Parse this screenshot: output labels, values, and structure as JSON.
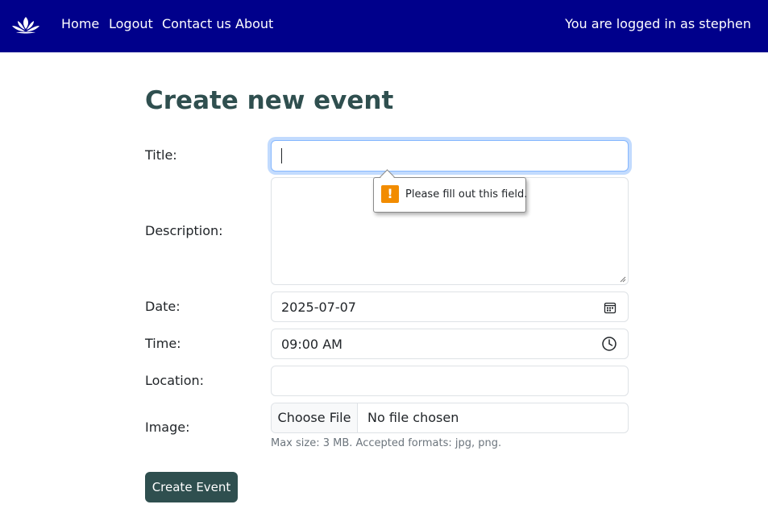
{
  "nav": {
    "logo": "lotus-logo-icon",
    "links": [
      "Home",
      "Logout",
      "Contact us",
      "About"
    ],
    "user_status": "You are logged in as stephen"
  },
  "form": {
    "heading": "Create new event",
    "labels": {
      "title": "Title:",
      "description": "Description:",
      "date": "Date:",
      "time": "Time:",
      "location": "Location:",
      "image": "Image:"
    },
    "values": {
      "title": "",
      "description": "",
      "date": "2025-07-07",
      "time": "09:00 AM",
      "location": ""
    },
    "file": {
      "button_label": "Choose File",
      "status": "No file chosen",
      "help": "Max size: 3 MB. Accepted formats: jpg, png."
    },
    "submit_label": "Create Event"
  },
  "validation": {
    "message": "Please fill out this field.",
    "icon": "warning-icon"
  },
  "colors": {
    "navbar_bg": "#00008b",
    "heading": "#2f4f4f",
    "button_bg": "#2f4f4f",
    "warning": "#f28c00",
    "focus_border": "#86b7fe"
  }
}
